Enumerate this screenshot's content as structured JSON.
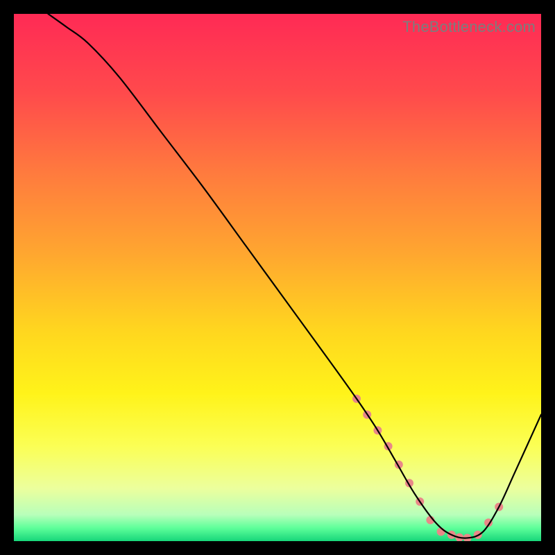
{
  "attribution": "TheBottleneck.com",
  "chart_data": {
    "type": "line",
    "title": "",
    "xlabel": "",
    "ylabel": "",
    "xlim": [
      0,
      100
    ],
    "ylim": [
      0,
      100
    ],
    "grid": false,
    "legend": false,
    "background_gradient": {
      "stops": [
        {
          "offset": 0.0,
          "color": "#ff2a55"
        },
        {
          "offset": 0.15,
          "color": "#ff4a4c"
        },
        {
          "offset": 0.3,
          "color": "#ff7a3e"
        },
        {
          "offset": 0.45,
          "color": "#ffa530"
        },
        {
          "offset": 0.6,
          "color": "#ffd61f"
        },
        {
          "offset": 0.72,
          "color": "#fff31a"
        },
        {
          "offset": 0.82,
          "color": "#fbff55"
        },
        {
          "offset": 0.9,
          "color": "#ecff9d"
        },
        {
          "offset": 0.95,
          "color": "#b8ffba"
        },
        {
          "offset": 0.975,
          "color": "#5eff9a"
        },
        {
          "offset": 1.0,
          "color": "#17d67a"
        }
      ]
    },
    "series": [
      {
        "name": "bottleneck-curve",
        "stroke": "#000000",
        "stroke_width": 2.2,
        "x": [
          6.5,
          10,
          14,
          20,
          28,
          36,
          44,
          52,
          60,
          65,
          69,
          72.5,
          76,
          80,
          83,
          86,
          89,
          92,
          95,
          100
        ],
        "y": [
          100,
          97.5,
          94.5,
          88,
          77.5,
          67,
          56,
          45,
          34,
          27,
          21,
          15,
          9,
          3.5,
          1.2,
          0.6,
          1.8,
          6.5,
          13,
          24
        ]
      }
    ],
    "markers": {
      "name": "valley-dots",
      "color": "#e98888",
      "radius": 6.0,
      "x": [
        65,
        67,
        69,
        71,
        73,
        75,
        77,
        79,
        81,
        83,
        84.5,
        86,
        88,
        90,
        92
      ],
      "y": [
        27,
        24,
        21,
        18,
        14.5,
        11,
        7.5,
        4,
        1.8,
        1.2,
        0.7,
        0.6,
        1.2,
        3.5,
        6.5
      ]
    }
  }
}
